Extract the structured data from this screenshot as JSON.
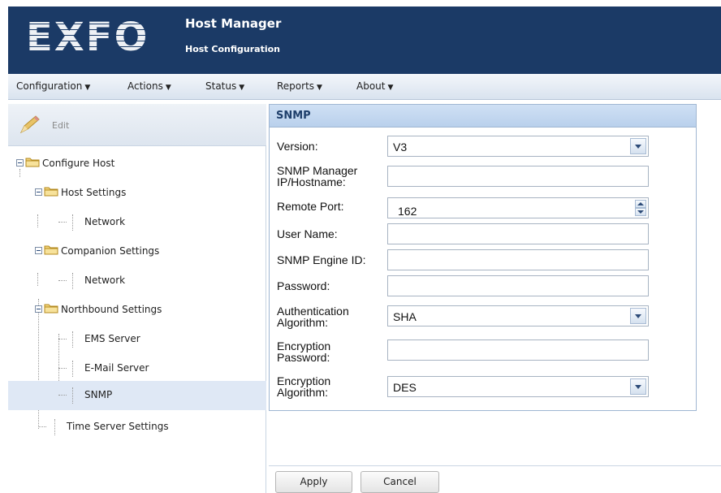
{
  "header": {
    "logo_text": "EXFO",
    "title": "Host Manager",
    "subtitle": "Host Configuration"
  },
  "menu": [
    {
      "label": "Configuration"
    },
    {
      "label": "Actions"
    },
    {
      "label": "Status"
    },
    {
      "label": "Reports"
    },
    {
      "label": "About"
    }
  ],
  "toolbar": {
    "edit_label": "Edit"
  },
  "tree": {
    "root": "Configure Host",
    "host_settings": "Host Settings",
    "host_network": "Network",
    "companion_settings": "Companion Settings",
    "companion_network": "Network",
    "northbound_settings": "Northbound Settings",
    "ems_server": "EMS Server",
    "email_server": "E-Mail Server",
    "snmp": "SNMP",
    "time_server_settings": "Time Server Settings",
    "selected": "SNMP"
  },
  "snmp_panel": {
    "title": "SNMP",
    "version": {
      "label": "Version:",
      "value": "V3"
    },
    "manager_host": {
      "label_line1": "SNMP Manager",
      "label_line2": "IP/Hostname:",
      "value": ""
    },
    "remote_port": {
      "label": "Remote Port:",
      "value": "162"
    },
    "user_name": {
      "label": "User Name:",
      "value": ""
    },
    "engine_id": {
      "label": "SNMP Engine ID:",
      "value": ""
    },
    "password": {
      "label": "Password:",
      "value": ""
    },
    "auth_algorithm": {
      "label_line1": "Authentication",
      "label_line2": "Algorithm:",
      "value": "SHA"
    },
    "encryption_password": {
      "label_line1": "Encryption",
      "label_line2": "Password:",
      "value": ""
    },
    "encryption_algorithm": {
      "label_line1": "Encryption",
      "label_line2": "Algorithm:",
      "value": "DES"
    }
  },
  "actions": {
    "apply_label": "Apply",
    "cancel_label": "Cancel"
  },
  "colors": {
    "header_bg": "#1b3a66",
    "selected_row": "#dfe8f5",
    "panel_title": "#1f3f6b"
  }
}
